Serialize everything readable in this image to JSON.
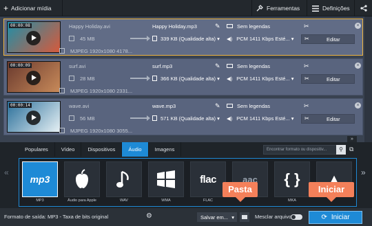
{
  "toolbar": {
    "add_label": "Adicionar mídia",
    "tools_label": "Ferramentas",
    "settings_label": "Definições"
  },
  "files": [
    {
      "duration": "00:00:08",
      "name": "Happy Holiday.avi",
      "size": "45 MB",
      "codec": "MJPEG 1920x1080 4178...",
      "output_name": "Happy Holiday.mp3",
      "output_size": "339 KB (Qualidade alta)",
      "subtitles": "Sem legendas",
      "audio": "PCM 1411 Kbps Esté...",
      "edit_label": "Editar",
      "selected": true,
      "thumb_colors": [
        "#1f8fa8",
        "#d65a3c"
      ]
    },
    {
      "duration": "00:00:09",
      "name": "surf.avi",
      "size": "28 MB",
      "codec": "MJPEG 1920x1080 2331...",
      "output_name": "surf.mp3",
      "output_size": "366 KB (Qualidade alta)",
      "subtitles": "Sem legendas",
      "audio": "PCM 1411 Kbps Esté...",
      "edit_label": "Editar",
      "selected": false,
      "thumb_colors": [
        "#6a3a2e",
        "#c88a5a"
      ]
    },
    {
      "duration": "00:00:14",
      "name": "wave.avi",
      "size": "56 MB",
      "codec": "MJPEG 1920x1080 3055...",
      "output_name": "wave.mp3",
      "output_size": "571 KB (Qualidade alta)",
      "subtitles": "Sem legendas",
      "audio": "PCM 1411 Kbps Esté...",
      "edit_label": "Editar",
      "selected": false,
      "thumb_colors": [
        "#2a6f9a",
        "#e6f0f4"
      ]
    }
  ],
  "tabs": [
    {
      "label": "Populares",
      "active": false
    },
    {
      "label": "Vídeo",
      "active": false
    },
    {
      "label": "Dispositivos",
      "active": false
    },
    {
      "label": "Áudio",
      "active": true
    },
    {
      "label": "Imagens",
      "active": false
    }
  ],
  "format_search_placeholder": "Encontrar formato ou dispositiv...",
  "formats": [
    {
      "label": "MP3",
      "icon": "mp3",
      "selected": true
    },
    {
      "label": "Áudio para Apple",
      "icon": "apple-icon",
      "selected": false
    },
    {
      "label": "WAV",
      "icon": "music-note-icon",
      "selected": false
    },
    {
      "label": "WMA",
      "icon": "windows-icon",
      "selected": false
    },
    {
      "label": "FLAC",
      "icon": "flac",
      "selected": false
    },
    {
      "label": "",
      "icon": "aac",
      "selected": false
    },
    {
      "label": "MKA",
      "icon": "mka-icon",
      "selected": false
    },
    {
      "label": "",
      "icon": "more-icon",
      "selected": false
    }
  ],
  "bottom": {
    "output_format": "Formato de saída: MP3 - Taxa de bits original",
    "save_to": "Salvar em...",
    "merge_label": "Mesclar arquivos",
    "start_label": "Iniciar"
  },
  "callouts": {
    "folder": "Pasta",
    "start": "Iniciar"
  },
  "colors": {
    "accent": "#1e8ad6",
    "selected_border": "#f0b640",
    "callout": "#f4805a"
  }
}
